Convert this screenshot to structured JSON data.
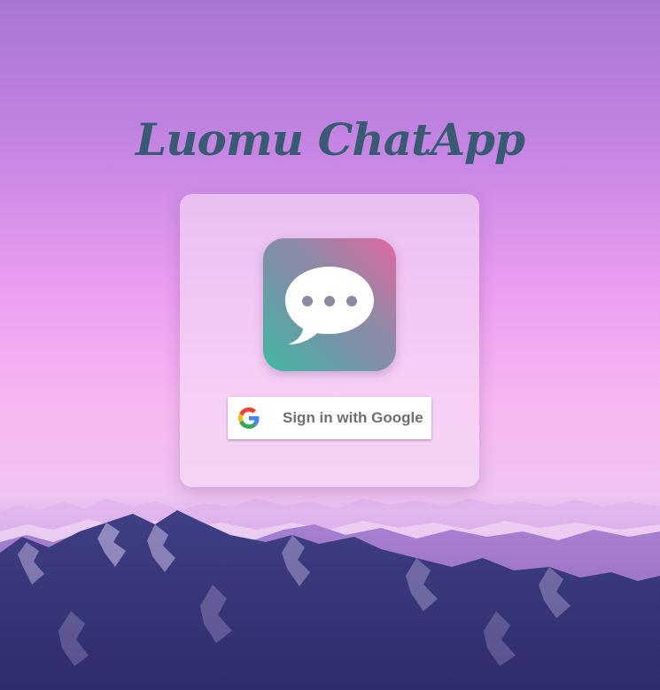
{
  "app": {
    "title": "Luomu ChatApp"
  },
  "login_card": {
    "logo_icon": "chat-bubble-icon",
    "google_button": {
      "label": "Sign in with Google",
      "icon": "google-g-icon"
    }
  },
  "colors": {
    "title": "#385a73",
    "logo_gradient_start": "#3fb8a3",
    "logo_gradient_end": "#e267a3",
    "button_text": "#6f6f6f"
  }
}
